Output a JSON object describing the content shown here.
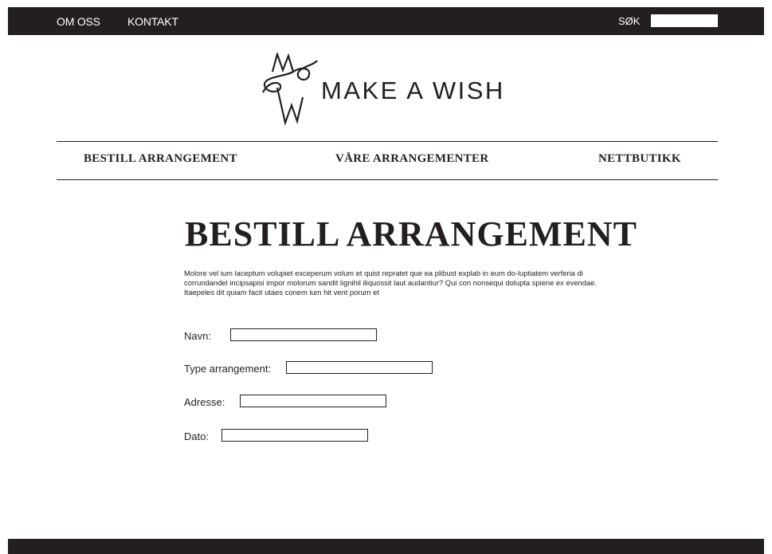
{
  "topbar": {
    "links": [
      {
        "label": "OM OSS"
      },
      {
        "label": "KONTAKT"
      }
    ],
    "search_label": "SØK",
    "search_value": ""
  },
  "logo": {
    "brand_name": "MAKE A WISH",
    "monogram": "MW"
  },
  "nav": {
    "items": [
      {
        "label": "BESTILL ARRANGEMENT"
      },
      {
        "label": "VÅRE ARRANGEMENTER"
      },
      {
        "label": "NETTBUTIKK"
      }
    ]
  },
  "main": {
    "title": "BESTILL ARRANGEMENT",
    "intro": "Molore vel ium laceptum volupiet exceperum volum et quist repratet que ea plibust explab in eum do-luptiatem verferia di corrundandel incipsapisi impor molorum sandit lignihil iliquossit laut audantiur? Qui con nonsequi dolupta spiene ex evendae. Itaepeles dit quiam facit utaes conem ium hit vent porum et",
    "form": {
      "fields": [
        {
          "label": "Navn:",
          "value": ""
        },
        {
          "label": "Type arrangement:",
          "value": ""
        },
        {
          "label": "Adresse:",
          "value": ""
        },
        {
          "label": "Dato:",
          "value": ""
        }
      ]
    }
  },
  "colors": {
    "dark": "#231f20",
    "background": "#ffffff"
  }
}
